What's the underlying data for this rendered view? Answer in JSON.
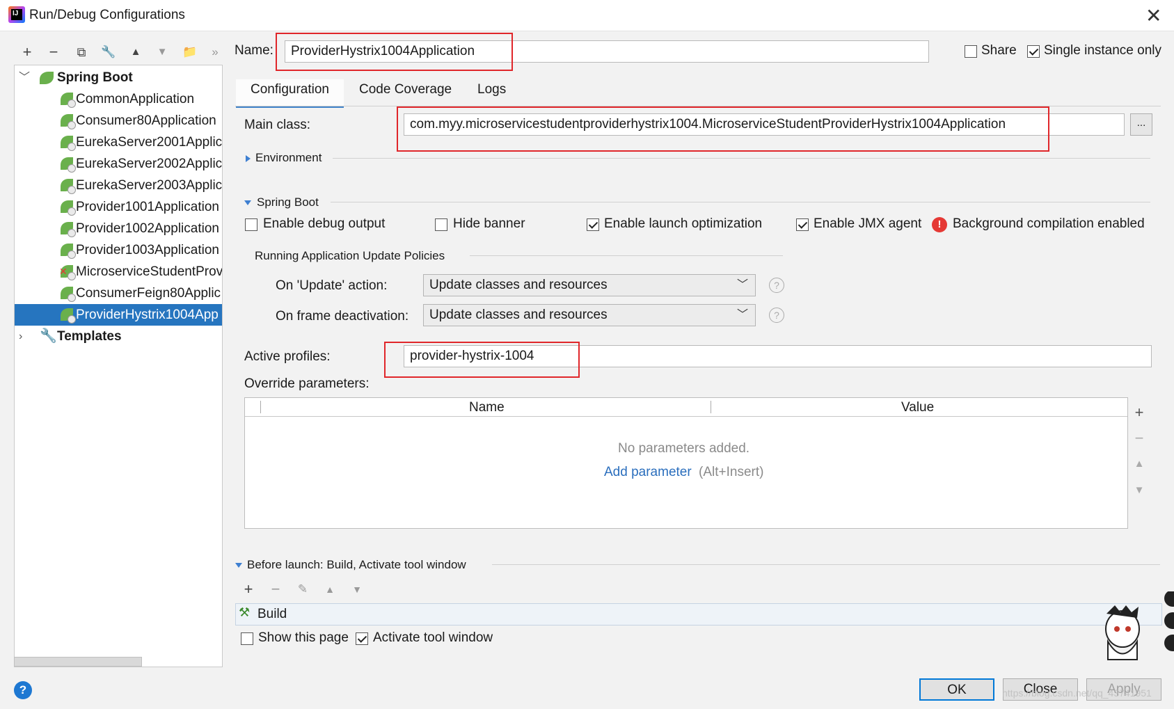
{
  "window": {
    "title": "Run/Debug Configurations",
    "close": "✕"
  },
  "toolbar": {
    "add": "+",
    "remove": "−",
    "copy": "⧉",
    "edit_defaults": "🔧",
    "move_up": "▲",
    "move_down": "▼",
    "folder": "📁",
    "more": "»"
  },
  "tree": {
    "group_spring_boot": "Spring Boot",
    "items": [
      {
        "label": "CommonApplication"
      },
      {
        "label": "Consumer80Application"
      },
      {
        "label": "EurekaServer2001Applic"
      },
      {
        "label": "EurekaServer2002Applic"
      },
      {
        "label": "EurekaServer2003Applic"
      },
      {
        "label": "Provider1001Application"
      },
      {
        "label": "Provider1002Application"
      },
      {
        "label": "Provider1003Application"
      },
      {
        "label": "MicroserviceStudentProv"
      },
      {
        "label": "ConsumerFeign80Applic"
      },
      {
        "label": "ProviderHystrix1004App"
      }
    ],
    "group_templates": "Templates"
  },
  "name_field": {
    "label": "Name:",
    "value": "ProviderHystrix1004Application"
  },
  "share": {
    "label": "Share",
    "checked": false
  },
  "single_instance": {
    "label": "Single instance only",
    "checked": true
  },
  "tabs": [
    "Configuration",
    "Code Coverage",
    "Logs"
  ],
  "main_class": {
    "label": "Main class:",
    "value": "com.myy.microservicestudentproviderhystrix1004.MicroserviceStudentProviderHystrix1004Application",
    "browse": "..."
  },
  "environment": {
    "label": "Environment"
  },
  "spring_boot": {
    "label": "Spring Boot",
    "enable_debug": {
      "label": "Enable debug output",
      "checked": false
    },
    "hide_banner": {
      "label": "Hide banner",
      "checked": false
    },
    "launch_opt": {
      "label": "Enable launch optimization",
      "checked": true
    },
    "jmx": {
      "label": "Enable JMX agent",
      "checked": true
    },
    "bg_compile": {
      "label": "Background compilation enabled",
      "icon": "error-icon"
    }
  },
  "update_policies": {
    "label": "Running Application Update Policies",
    "on_update": {
      "label": "On 'Update' action:",
      "value": "Update classes and resources"
    },
    "on_frame": {
      "label": "On frame deactivation:",
      "value": "Update classes and resources"
    },
    "help": "?"
  },
  "active_profiles": {
    "label": "Active profiles:",
    "value": "provider-hystrix-1004"
  },
  "override": {
    "label": "Override parameters:",
    "col_name": "Name",
    "col_value": "Value",
    "empty": "No parameters added.",
    "add_link": "Add parameter",
    "shortcut": "(Alt+Insert)"
  },
  "before_launch": {
    "label": "Before launch: Build, Activate tool window",
    "build_item": "Build",
    "show_page": {
      "label": "Show this page",
      "checked": false
    },
    "activate_tool": {
      "label": "Activate tool window",
      "checked": true
    }
  },
  "buttons": {
    "ok": "OK",
    "close": "Close",
    "apply": "Apply",
    "help": "?"
  },
  "watermark": "https://blog.csdn.net/qq_43741951",
  "colors": {
    "selection": "#2675bf",
    "red_highlight": "#e0262a",
    "link": "#2a6ebd",
    "spring_green": "#6ab04c"
  }
}
